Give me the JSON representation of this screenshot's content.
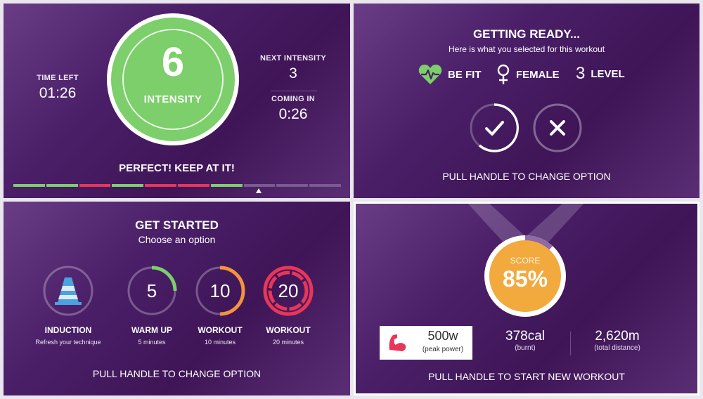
{
  "intensity": {
    "time_left_label": "TIME LEFT",
    "time_left": "01:26",
    "current": "6",
    "current_label": "INTENSITY",
    "next_label": "NEXT INTENSITY",
    "next_value": "3",
    "coming_label": "COMING IN",
    "coming_value": "0:26",
    "message": "PERFECT! KEEP AT IT!",
    "segments": [
      "green",
      "green",
      "red",
      "green",
      "red",
      "red",
      "green",
      "dim",
      "dim",
      "dim"
    ],
    "marker_index": 7
  },
  "getting_ready": {
    "title": "GETTING READY...",
    "subtitle": "Here is what you selected for this workout",
    "goal": "BE FIT",
    "gender": "FEMALE",
    "level_value": "3",
    "level_label": "LEVEL",
    "hint": "PULL HANDLE TO CHANGE OPTION"
  },
  "get_started": {
    "title": "GET STARTED",
    "subtitle": "Choose an option",
    "options": [
      {
        "value": "",
        "label": "INDUCTION",
        "sub": "Refresh your technique",
        "icon": "cone-icon"
      },
      {
        "value": "5",
        "label": "WARM UP",
        "sub": "5 minutes",
        "color": "#7ccf6a",
        "progress": 0.25
      },
      {
        "value": "10",
        "label": "WORKOUT",
        "sub": "10 minutes",
        "color": "#f2943e",
        "progress": 0.5
      },
      {
        "value": "20",
        "label": "WORKOUT",
        "sub": "20 minutes",
        "color": "#e8365a",
        "progress": 1.0
      }
    ],
    "hint": "PULL HANDLE TO CHANGE OPTION"
  },
  "results": {
    "score_label": "SCORE",
    "score_value": "85%",
    "score_fraction": 0.85,
    "power_value": "500w",
    "power_label": "(peak power)",
    "cal_value": "378cal",
    "cal_label": "(burnt)",
    "dist_value": "2,620m",
    "dist_label": "(total distance)",
    "hint": "PULL HANDLE TO START NEW WORKOUT"
  },
  "colors": {
    "green": "#7ccf6a",
    "red": "#e8365a",
    "orange": "#f2a93e",
    "dim": "#7a5b8f",
    "brand_purple": "#4a1f68"
  }
}
